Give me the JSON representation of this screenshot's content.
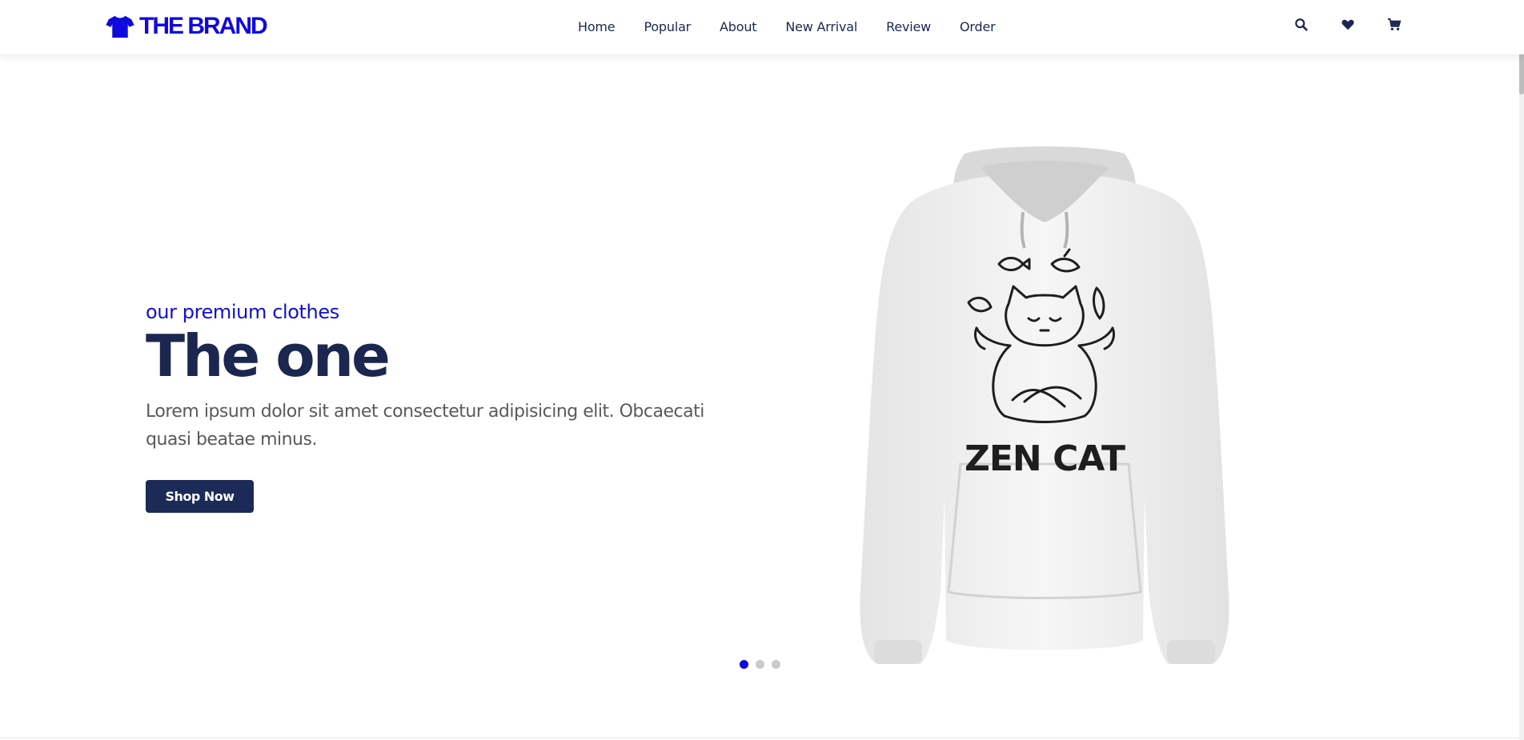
{
  "brand": {
    "name": "THE BRAND",
    "color": "#1009dd",
    "logo_icon": "tshirt-icon"
  },
  "nav": {
    "items": [
      {
        "label": "Home"
      },
      {
        "label": "Popular"
      },
      {
        "label": "About"
      },
      {
        "label": "New Arrival"
      },
      {
        "label": "Review"
      },
      {
        "label": "Order"
      }
    ]
  },
  "header_icons": [
    {
      "name": "search-icon"
    },
    {
      "name": "heart-icon"
    },
    {
      "name": "cart-icon"
    }
  ],
  "hero": {
    "subtitle": "our premium clothes",
    "title": "The one",
    "description": "Lorem ipsum dolor sit amet consectetur adipisicing elit. Obcaecati quasi beatae minus.",
    "button_label": "Shop Now",
    "product_print": "ZEN CAT"
  },
  "slider": {
    "slide_count": 3,
    "active_index": 0
  },
  "colors": {
    "accent": "#1009dd",
    "navy": "#1c2a58",
    "text_gray": "#5a5a5a"
  }
}
